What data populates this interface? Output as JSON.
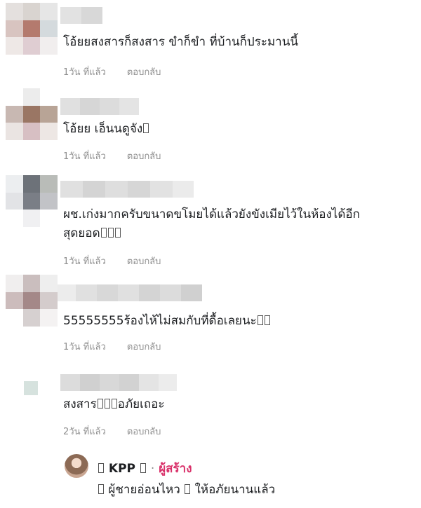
{
  "comments": [
    {
      "text": "โอ้ยยสงสารก็สงสาร ขำก็ขำ ที่บ้านก็ประมานนี้",
      "time": "1วัน ที่แล้ว",
      "reply_label": "ตอบกลับ"
    },
    {
      "text": "โอ้ยย เอ็นนดูจัง",
      "time": "1วัน ที่แล้ว",
      "reply_label": "ตอบกลับ"
    },
    {
      "text_line1": "ผช.เก่งมากครับขนาดขโมยได้แล้วยังขังเมียไว้ในห้องได้อีก",
      "text_line2": "สุดยอด",
      "time": "1วัน ที่แล้ว",
      "reply_label": "ตอบกลับ"
    },
    {
      "text": "55555555ร้องไห้ไม่สมกับที่ดื้อเลยนะ",
      "time": "1วัน ที่แล้ว",
      "reply_label": "ตอบกลับ"
    },
    {
      "text_a": "สงสาร",
      "text_b": "อภัยเถอะ",
      "time": "2วัน ที่แล้ว",
      "reply_label": "ตอบกลับ"
    }
  ],
  "creator_reply": {
    "name": "KPP",
    "separator": "·",
    "creator_label": "ผู้สร้าง",
    "text_a": "ผู้ชายอ่อนไหว",
    "text_b": "ให้อภัยนานแล้ว"
  },
  "colors": {
    "creator_accent": "#d9316a",
    "meta_gray": "#8e8e8e"
  }
}
